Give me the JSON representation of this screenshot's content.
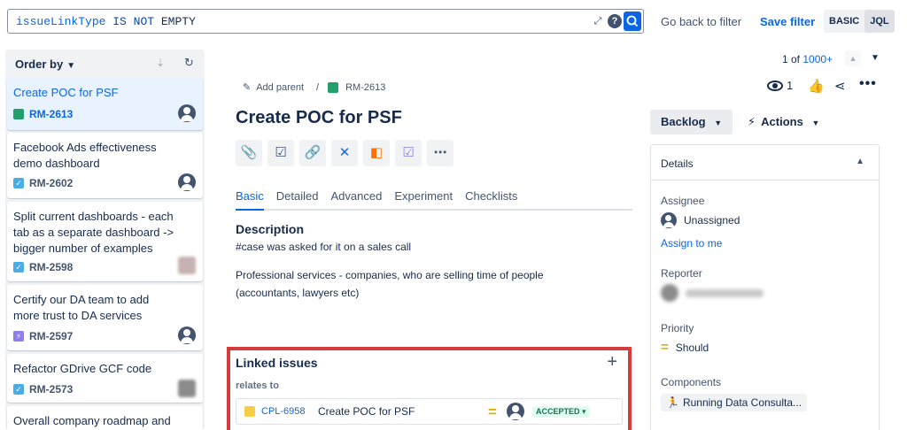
{
  "search": {
    "query_field": "issueLinkType",
    "query_op": "IS NOT",
    "query_value": "EMPTY",
    "go_back": "Go back to filter",
    "save_filter": "Save filter",
    "mode_basic": "BASIC",
    "mode_jql": "JQL"
  },
  "list": {
    "order_by": "Order by",
    "items": [
      {
        "title": "Create POC for PSF",
        "key": "RM-2613",
        "type": "story"
      },
      {
        "title": "Facebook Ads effectiveness demo dashboard",
        "key": "RM-2602",
        "type": "task"
      },
      {
        "title": "Split current dashboards - each tab as a separate dashboard -> bigger number of examples",
        "key": "RM-2598",
        "type": "task"
      },
      {
        "title": "Certify our DA team to add more trust to DA services",
        "key": "RM-2597",
        "type": "subtask"
      },
      {
        "title": "Refactor GDrive GCF code",
        "key": "RM-2573",
        "type": "task"
      },
      {
        "title": "Overall company roadmap and OKRs"
      }
    ]
  },
  "issue": {
    "add_parent": "Add parent",
    "key": "RM-2613",
    "title": "Create POC for PSF",
    "tabs": [
      "Basic",
      "Detailed",
      "Advanced",
      "Experiment",
      "Checklists"
    ],
    "description_title": "Description",
    "description_lines": [
      "#case was asked for it on a sales call",
      "Professional services - companies, who are selling time of people",
      "(accountants, lawyers etc)"
    ],
    "linked": {
      "title": "Linked issues",
      "relation": "relates to",
      "key": "CPL-6958",
      "summary": "Create POC for PSF",
      "status": "ACCEPTED"
    }
  },
  "sidebar": {
    "pager_prefix": "1 of",
    "pager_total": "1000+",
    "watchers": "1",
    "status_button": "Backlog",
    "actions_button": "Actions",
    "details_title": "Details",
    "assignee_label": "Assignee",
    "assignee_value": "Unassigned",
    "assign_to_me": "Assign to me",
    "reporter_label": "Reporter",
    "priority_label": "Priority",
    "priority_value": "Should",
    "components_label": "Components",
    "component_value": "Running Data Consulta..."
  },
  "colors": {
    "accent": "#0c66e4",
    "highlight_border": "#d63c3c",
    "accepted_text": "#216e4e",
    "priority_medium": "#e2b203"
  }
}
